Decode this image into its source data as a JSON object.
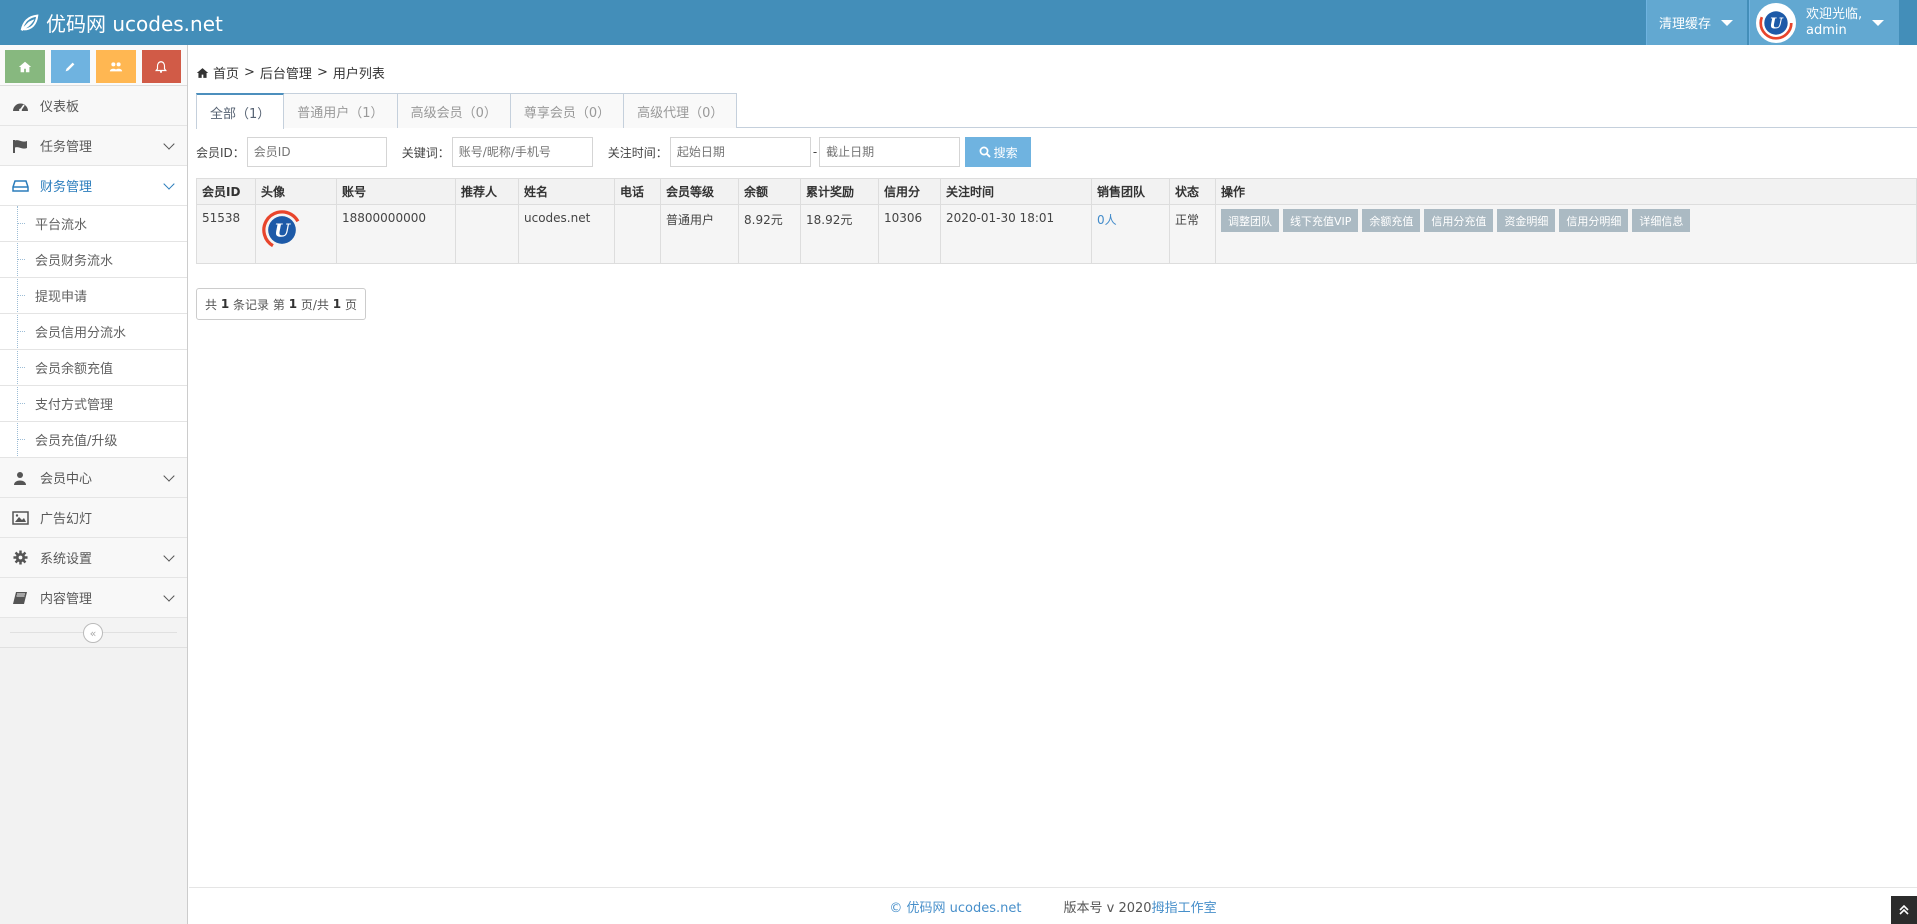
{
  "navbar": {
    "brand": "优码网 ucodes.net",
    "clear_cache": "清理缓存",
    "welcome": "欢迎光临,",
    "username": "admin"
  },
  "sidebar": {
    "shortcut_colors": [
      "#87b87f",
      "#6fb3e0",
      "#ffb752",
      "#d15b47"
    ],
    "items": [
      {
        "label": "仪表板",
        "icon": "dashboard-icon"
      },
      {
        "label": "任务管理",
        "icon": "flag-icon"
      },
      {
        "label": "财务管理",
        "icon": "drive-icon"
      },
      {
        "label": "会员中心",
        "icon": "user-icon"
      },
      {
        "label": "广告幻灯",
        "icon": "picture-icon"
      },
      {
        "label": "系统设置",
        "icon": "gear-icon"
      },
      {
        "label": "内容管理",
        "icon": "book-icon"
      }
    ],
    "finance_sub": [
      "平台流水",
      "会员财务流水",
      "提现申请",
      "会员信用分流水",
      "会员余额充值",
      "支付方式管理",
      "会员充值/升级"
    ],
    "collapse": "«"
  },
  "breadcrumb": {
    "home": "首页",
    "level2": "后台管理",
    "current": "用户列表",
    "sep": ">"
  },
  "tabs": [
    "全部（1）",
    "普通用户（1）",
    "高级会员（0）",
    "尊享会员（0）",
    "高级代理（0）"
  ],
  "filters": {
    "member_id_label": "会员ID：",
    "member_id_placeholder": "会员ID",
    "keyword_label": "关键词：",
    "keyword_placeholder": "账号/昵称/手机号",
    "time_label": "关注时间：",
    "start_placeholder": "起始日期",
    "dash": "-",
    "end_placeholder": "截止日期",
    "search": "搜索"
  },
  "table": {
    "headers": [
      "会员ID",
      "头像",
      "账号",
      "推荐人",
      "姓名",
      "电话",
      "会员等级",
      "余额",
      "累计奖励",
      "信用分",
      "关注时间",
      "销售团队",
      "状态",
      "操作"
    ],
    "rows": [
      {
        "id": "51538",
        "account": "18800000000",
        "referrer": "",
        "name": "ucodes.net",
        "phone": "",
        "level": "普通用户",
        "balance": "8.92元",
        "reward": "18.92元",
        "credit": "10306",
        "follow_time": "2020-01-30 18:01",
        "team": "0人",
        "status": "正常",
        "ops": [
          "调整团队",
          "线下充值VIP",
          "余额充值",
          "信用分充值",
          "资金明细",
          "信用分明细",
          "详细信息"
        ]
      }
    ]
  },
  "pager": {
    "p1": "共",
    "total": "1",
    "p2": "条记录 第",
    "page": "1",
    "p3": "页/共",
    "pages": "1",
    "p4": "页"
  },
  "footer": {
    "brand": "© 优码网 ucodes.net",
    "version": "版本号 v 2020 ",
    "studio": "拇指工作室"
  }
}
